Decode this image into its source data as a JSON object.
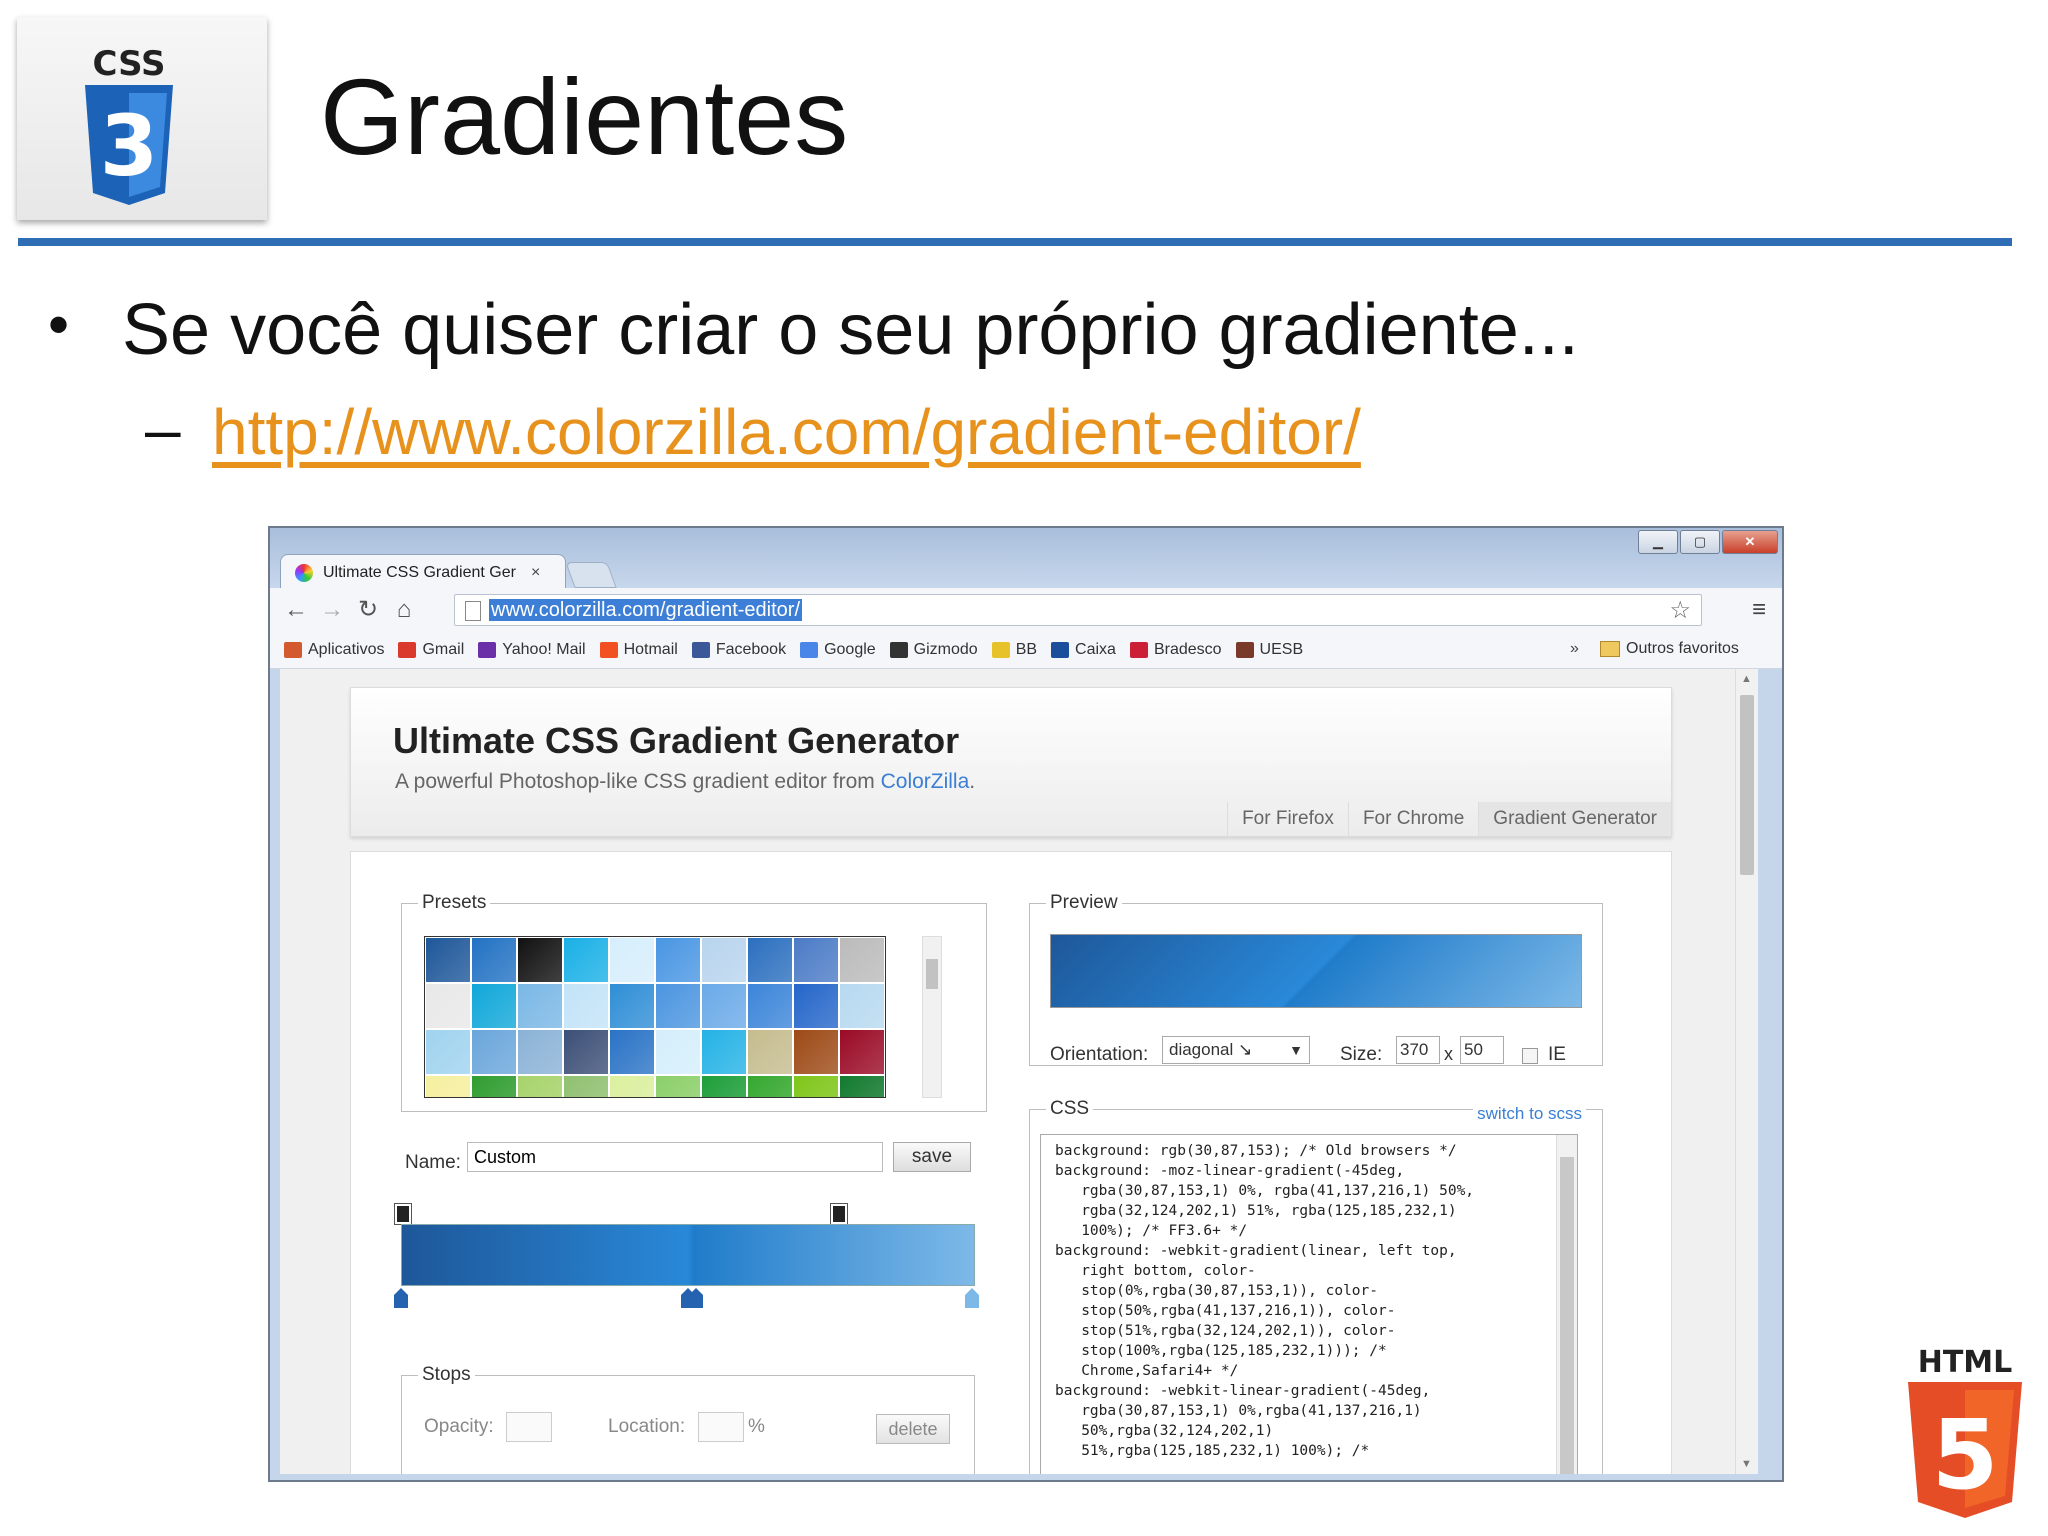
{
  "slide": {
    "title": "Gradientes",
    "bullet_marker": "•",
    "bullet": "Se você quiser criar o seu próprio gradiente...",
    "sub_marker": "–",
    "link": "http://www.colorzilla.com/gradient-editor/",
    "css3_logo_text": "CSS",
    "css3_logo_digit": "3",
    "html5_logo_text": "HTML",
    "html5_logo_digit": "5",
    "rule_color": "#2f6db5",
    "link_color": "#e8921e"
  },
  "browser": {
    "window_buttons": {
      "minimize": "▁",
      "maximize": "▢",
      "close": "✕"
    },
    "tab": {
      "title": "Ultimate CSS Gradient Ger",
      "close": "×"
    },
    "nav": {
      "back": "←",
      "forward": "→",
      "reload": "↻",
      "home": "⌂"
    },
    "url": "www.colorzilla.com/gradient-editor/",
    "star": "☆",
    "menu": "≡",
    "bookmarks": [
      {
        "label": "Aplicativos",
        "icon": "apps-grid-icon",
        "color": "#d35a2e"
      },
      {
        "label": "Gmail",
        "icon": "gmail-icon",
        "color": "#d93a2b"
      },
      {
        "label": "Yahoo! Mail",
        "icon": "yahoo-mail-icon",
        "color": "#6b2fa8"
      },
      {
        "label": "Hotmail",
        "icon": "hotmail-icon",
        "color": "#f25022"
      },
      {
        "label": "Facebook",
        "icon": "facebook-icon",
        "color": "#3b5998"
      },
      {
        "label": "Google",
        "icon": "google-icon",
        "color": "#4a86e8"
      },
      {
        "label": "Gizmodo",
        "icon": "gizmodo-icon",
        "color": "#333333"
      },
      {
        "label": "BB",
        "icon": "bb-icon",
        "color": "#e8c22a"
      },
      {
        "label": "Caixa",
        "icon": "caixa-icon",
        "color": "#1b4f9c"
      },
      {
        "label": "Bradesco",
        "icon": "bradesco-icon",
        "color": "#cc2036"
      },
      {
        "label": "UESB",
        "icon": "uesb-icon",
        "color": "#7a3a2a"
      }
    ],
    "bookmarks_more": "»",
    "other_bookmarks": "Outros favoritos"
  },
  "page": {
    "title": "Ultimate CSS Gradient Generator",
    "subtitle_prefix": "A powerful Photoshop-like CSS gradient editor from ",
    "subtitle_link": "ColorZilla",
    "subtitle_suffix": ".",
    "nav_tabs": [
      "For Firefox",
      "For Chrome",
      "Gradient Generator"
    ],
    "presets_legend": "Presets",
    "presets_colors": [
      "#1e5799",
      "#2272c3",
      "#111111",
      "#1ab0e6",
      "#d6eefc",
      "#4996e3",
      "#b8d4ee",
      "#2b6fbf",
      "#4b7bc6",
      "#bbbbbb",
      "#e8e8e8",
      "#10a7d9",
      "#7ab7e6",
      "#c2e3f7",
      "#2f8ed6",
      "#4b95e0",
      "#6aaae8",
      "#3c85d9",
      "#2466c9",
      "#b7d9f0",
      "#9fd3ef",
      "#6aa6db",
      "#8ab2d6",
      "#3c4f77",
      "#2a73c6",
      "#d4eefb",
      "#24b2e6",
      "#c5bc8e",
      "#9d4a16",
      "#9a0a26",
      "#f6ef9f",
      "#2f9d2f",
      "#a7d36b",
      "#90c070",
      "#dbef9e",
      "#8ccf6a",
      "#1e9e3a",
      "#35a82f",
      "#7fc61a",
      "#127a2f"
    ],
    "name_label": "Name:",
    "name_value": "Custom",
    "save_label": "save",
    "stops_legend": "Stops",
    "opacity_label": "Opacity:",
    "location_label": "Location:",
    "percent": "%",
    "delete_label": "delete",
    "preview_legend": "Preview",
    "orientation_label": "Orientation:",
    "orientation_value": "diagonal ↘",
    "size_label": "Size:",
    "size_w": "370",
    "size_x": "x",
    "size_h": "50",
    "ie_label": "IE",
    "css_legend": "CSS",
    "switch_scss": "switch to scss",
    "css_code": "background: rgb(30,87,153); /* Old browsers */\nbackground: -moz-linear-gradient(-45deg,\n   rgba(30,87,153,1) 0%, rgba(41,137,216,1) 50%,\n   rgba(32,124,202,1) 51%, rgba(125,185,232,1)\n   100%); /* FF3.6+ */\nbackground: -webkit-gradient(linear, left top,\n   right bottom, color-\n   stop(0%,rgba(30,87,153,1)), color-\n   stop(50%,rgba(41,137,216,1)), color-\n   stop(51%,rgba(32,124,202,1)), color-\n   stop(100%,rgba(125,185,232,1))); /*\n   Chrome,Safari4+ */\nbackground: -webkit-linear-gradient(-45deg,\n   rgba(30,87,153,1) 0%,rgba(41,137,216,1)\n   50%,rgba(32,124,202,1)\n   51%,rgba(125,185,232,1) 100%); /*"
  }
}
